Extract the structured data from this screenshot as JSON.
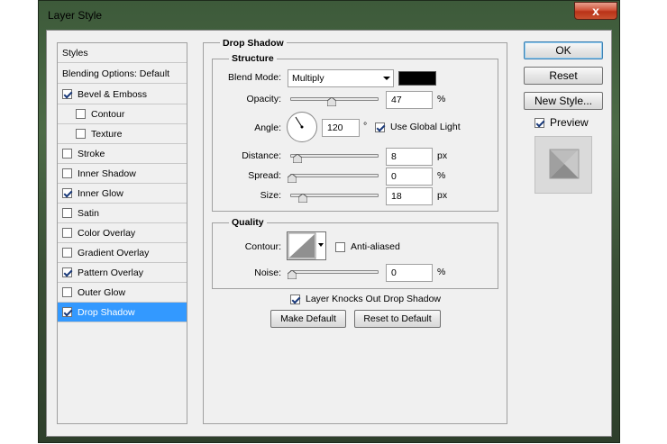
{
  "window": {
    "title": "Layer Style",
    "close_glyph": "x"
  },
  "styles_list": {
    "items": [
      {
        "label": "Styles",
        "kind": "header",
        "checked": null
      },
      {
        "label": "Blending Options: Default",
        "kind": "header",
        "checked": null
      },
      {
        "label": "Bevel & Emboss",
        "kind": "item",
        "checked": true
      },
      {
        "label": "Contour",
        "kind": "sub",
        "checked": false
      },
      {
        "label": "Texture",
        "kind": "sub",
        "checked": false
      },
      {
        "label": "Stroke",
        "kind": "item",
        "checked": false
      },
      {
        "label": "Inner Shadow",
        "kind": "item",
        "checked": false
      },
      {
        "label": "Inner Glow",
        "kind": "item",
        "checked": true
      },
      {
        "label": "Satin",
        "kind": "item",
        "checked": false
      },
      {
        "label": "Color Overlay",
        "kind": "item",
        "checked": false
      },
      {
        "label": "Gradient Overlay",
        "kind": "item",
        "checked": false
      },
      {
        "label": "Pattern Overlay",
        "kind": "item",
        "checked": true
      },
      {
        "label": "Outer Glow",
        "kind": "item",
        "checked": false
      },
      {
        "label": "Drop Shadow",
        "kind": "item",
        "checked": true,
        "selected": true
      }
    ]
  },
  "drop_shadow": {
    "group_title": "Drop Shadow",
    "structure_title": "Structure",
    "blend_mode_label": "Blend Mode:",
    "blend_mode_value": "Multiply",
    "shadow_color": "#000000",
    "opacity_label": "Opacity:",
    "opacity_value": "47",
    "opacity_unit": "%",
    "angle_label": "Angle:",
    "angle_value": "120",
    "angle_unit": "°",
    "use_global_light_label": "Use Global Light",
    "use_global_light_checked": true,
    "distance_label": "Distance:",
    "distance_value": "8",
    "distance_unit": "px",
    "spread_label": "Spread:",
    "spread_value": "0",
    "spread_unit": "%",
    "size_label": "Size:",
    "size_value": "18",
    "size_unit": "px"
  },
  "quality": {
    "title": "Quality",
    "contour_label": "Contour:",
    "anti_aliased_label": "Anti-aliased",
    "anti_aliased_checked": false,
    "noise_label": "Noise:",
    "noise_value": "0",
    "noise_unit": "%"
  },
  "bottom": {
    "knocks_out_label": "Layer Knocks Out Drop Shadow",
    "knocks_out_checked": true,
    "make_default_label": "Make Default",
    "reset_default_label": "Reset to Default"
  },
  "actions": {
    "ok_label": "OK",
    "reset_label": "Reset",
    "new_style_label": "New Style...",
    "preview_label": "Preview",
    "preview_checked": true
  },
  "colors": {
    "selection": "#3399ff",
    "dialog_bg": "#f0f0f0"
  }
}
